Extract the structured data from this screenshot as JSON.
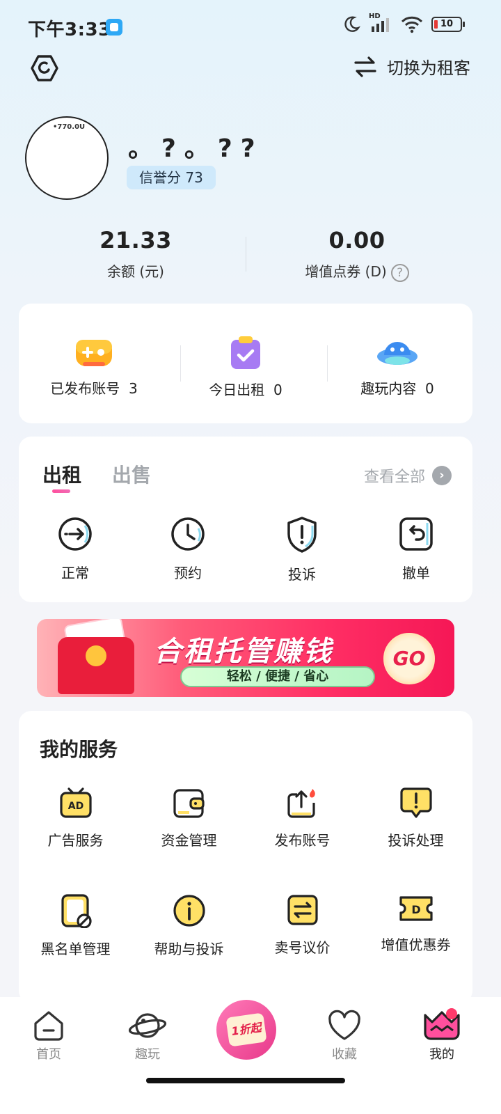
{
  "status_bar": {
    "time": "下午3:33",
    "battery": "10",
    "network": "HD"
  },
  "header": {
    "switch_label": "切换为租客"
  },
  "profile": {
    "avatar_tag": "•770.0U",
    "username": "。?。??",
    "credit_label": "信誉分 73"
  },
  "balances": [
    {
      "value": "21.33",
      "label": "余额 (元)"
    },
    {
      "value": "0.00",
      "label": "增值点券 (D)",
      "help": "?"
    }
  ],
  "stats": [
    {
      "label": "已发布账号",
      "count": "3"
    },
    {
      "label": "今日出租",
      "count": "0"
    },
    {
      "label": "趣玩内容",
      "count": "0"
    }
  ],
  "orders": {
    "tabs": [
      {
        "label": "出租",
        "active": true
      },
      {
        "label": "出售",
        "active": false
      }
    ],
    "view_all": "查看全部",
    "items": [
      {
        "label": "正常",
        "icon": "arrow-right-circle-icon"
      },
      {
        "label": "预约",
        "icon": "clock-icon"
      },
      {
        "label": "投诉",
        "icon": "shield-alert-icon"
      },
      {
        "label": "撤单",
        "icon": "undo-icon"
      }
    ]
  },
  "banner": {
    "title": "合租托管赚钱",
    "subtitle": "轻松 / 便捷 / 省心",
    "cta": "GO"
  },
  "services": {
    "title": "我的服务",
    "items": [
      {
        "label": "广告服务",
        "icon": "ad-tv-icon"
      },
      {
        "label": "资金管理",
        "icon": "wallet-icon"
      },
      {
        "label": "发布账号",
        "icon": "upload-icon"
      },
      {
        "label": "投诉处理",
        "icon": "complaint-icon"
      },
      {
        "label": "黑名单管理",
        "icon": "blacklist-icon"
      },
      {
        "label": "帮助与投诉",
        "icon": "info-icon"
      },
      {
        "label": "卖号议价",
        "icon": "exchange-icon"
      },
      {
        "label": "增值优惠券",
        "icon": "coupon-icon"
      }
    ]
  },
  "bottom_nav": {
    "items": [
      {
        "label": "首页",
        "icon": "home-icon"
      },
      {
        "label": "趣玩",
        "icon": "planet-icon"
      },
      {
        "label": "",
        "icon": "discount-fab-icon",
        "fab_text": "1折起"
      },
      {
        "label": "收藏",
        "icon": "heart-icon"
      },
      {
        "label": "我的",
        "icon": "profile-icon",
        "active": true
      }
    ]
  },
  "colors": {
    "accent": "#ff4f9d",
    "yellow": "#ffe066",
    "card_bg": "#ffffff",
    "muted": "#a4a8ad"
  }
}
